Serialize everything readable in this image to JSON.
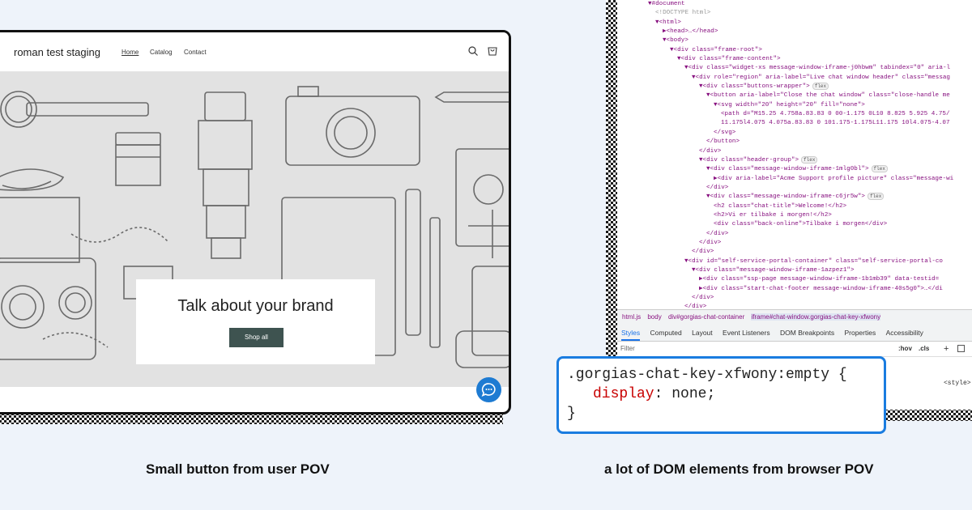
{
  "shop": {
    "store_name": "roman test staging",
    "nav": [
      "Home",
      "Catalog",
      "Contact"
    ],
    "hero_title": "Talk about your brand",
    "shop_button": "Shop all",
    "icons": [
      "search-icon",
      "cart-icon",
      "chat-icon"
    ]
  },
  "devtools": {
    "dom_lines": [
      {
        "indent": 0,
        "text": "▼#document"
      },
      {
        "indent": 1,
        "text": "<!DOCTYPE html>",
        "grey": true
      },
      {
        "indent": 1,
        "text": "▼<html>"
      },
      {
        "indent": 2,
        "text": "▶<head>…</head>"
      },
      {
        "indent": 2,
        "text": "▼<body>"
      },
      {
        "indent": 3,
        "text": "▼<div class=\"frame-root\">"
      },
      {
        "indent": 4,
        "text": "▼<div class=\"frame-content\">"
      },
      {
        "indent": 5,
        "text": "▼<div class=\"widget-xs message-window-iframe-j0hbwm\" tabindex=\"0\" aria-l"
      },
      {
        "indent": 6,
        "text": "▼<div role=\"region\" aria-label=\"Live chat window header\" class=\"messag"
      },
      {
        "indent": 7,
        "text": "▼<div class=\"buttons-wrapper\">",
        "badge": "flex"
      },
      {
        "indent": 8,
        "text": "▼<button aria-label=\"Close the chat window\" class=\"close-handle me"
      },
      {
        "indent": 9,
        "text": "▼<svg width=\"20\" height=\"20\" fill=\"none\">"
      },
      {
        "indent": 10,
        "text": "<path d=\"M15.25 4.758a.83.83 0 00-1.175 0L10 8.825 5.925 4.75/"
      },
      {
        "indent": 10,
        "text": "11.175l4.075 4.075a.83.83 0 101.175-1.175L11.175 10l4.075-4.07"
      },
      {
        "indent": 9,
        "text": "</svg>"
      },
      {
        "indent": 8,
        "text": "</button>"
      },
      {
        "indent": 7,
        "text": "</div>"
      },
      {
        "indent": 7,
        "text": "▼<div class=\"header-group\">",
        "badge": "flex"
      },
      {
        "indent": 8,
        "text": "▼<div class=\"message-window-iframe-1mlg0bl\">",
        "badge": "flex"
      },
      {
        "indent": 9,
        "text": "▶<div aria-label=\"Acme Support profile picture\" class=\"message-wi"
      },
      {
        "indent": 8,
        "text": "</div>"
      },
      {
        "indent": 8,
        "text": "▼<div class=\"message-window-iframe-c6jr5w\">",
        "badge": "flex"
      },
      {
        "indent": 9,
        "text": "<h2 class=\"chat-title\">Welcome!</h2>"
      },
      {
        "indent": 9,
        "text": "<h2>Vi er tilbake i morgen!</h2>"
      },
      {
        "indent": 9,
        "text": "<div class=\"back-online\">Tilbake i morgen</div>"
      },
      {
        "indent": 8,
        "text": "</div>"
      },
      {
        "indent": 7,
        "text": "</div>"
      },
      {
        "indent": 6,
        "text": "</div>"
      },
      {
        "indent": 5,
        "text": "▼<div id=\"self-service-portal-container\" class=\"self-service-portal-co"
      },
      {
        "indent": 6,
        "text": "▼<div class=\"message-window-iframe-1azpez1\">"
      },
      {
        "indent": 7,
        "text": "▶<div class=\"ssp-page message-window-iframe-1b1mb39\" data-testid="
      },
      {
        "indent": 7,
        "text": "▶<div class=\"start-chat-footer message-window-iframe-40s5g0\">…</di"
      },
      {
        "indent": 6,
        "text": "</div>"
      },
      {
        "indent": 5,
        "text": "</div>"
      }
    ],
    "breadcrumbs": [
      "html.js",
      "body",
      "div#gorgias-chat-container",
      "iframe#chat-window.gorgias-chat-key-xfwony"
    ],
    "tabs": [
      "Styles",
      "Computed",
      "Layout",
      "Event Listeners",
      "DOM Breakpoints",
      "Properties",
      "Accessibility"
    ],
    "filter_placeholder": "Filter",
    "filter_tools": [
      ":hov",
      ".cls",
      "+"
    ],
    "style_source": "<style>"
  },
  "css_rule": {
    "selector": ".gorgias-chat-key-xfwony:empty {",
    "property": "display",
    "value": " none;",
    "close": "}"
  },
  "captions": {
    "left": "Small button from user POV",
    "right": "a lot of DOM elements from browser POV"
  }
}
